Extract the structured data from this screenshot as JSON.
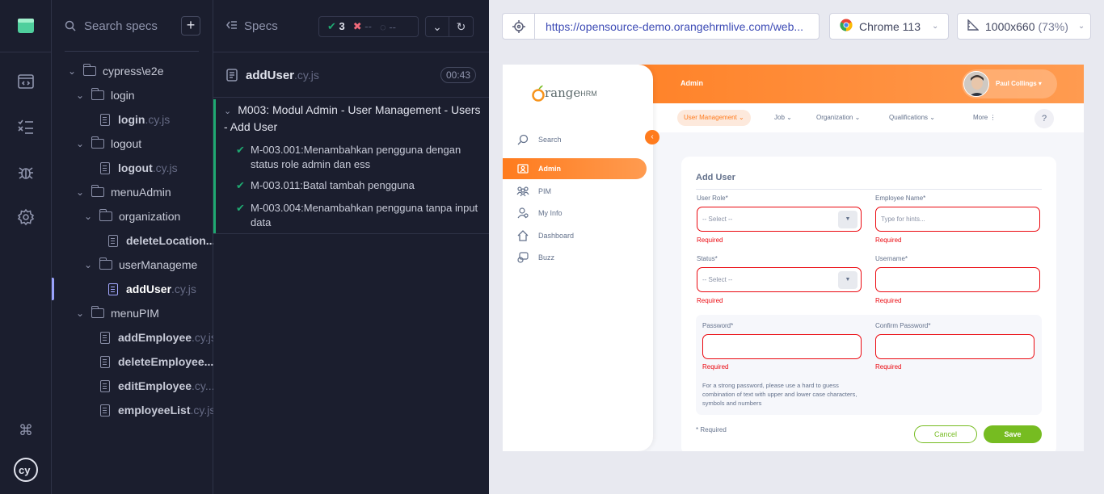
{
  "specs_panel": {
    "search_placeholder": "Search specs",
    "add_label": "+",
    "tree": {
      "root": "cypress\\e2e",
      "login_folder": "login",
      "login_file": "login",
      "logout_folder": "logout",
      "logout_file": "logout",
      "menuadmin_folder": "menuAdmin",
      "organization_folder": "organization",
      "delete_location_file": "deleteLocation...",
      "usermanagement_folder": "userManageme",
      "adduser_file": "addUser",
      "menupim_folder": "menuPIM",
      "addemployee_file": "addEmployee",
      "deleteemployee_file": "deleteEmployee...",
      "editemployee_file": "editEmployee",
      "editemployee_ext": ".cy...",
      "employeelist_file": "employeeList",
      "ext": ".cy.js"
    }
  },
  "reporter": {
    "specs_label": "Specs",
    "passed_count": "3",
    "failed_count": "--",
    "pending_count": "--",
    "spec_name": "addUser",
    "spec_ext": ".cy.js",
    "duration": "00:43",
    "suite_title": "M003: Modul Admin - User Management - Users - Add User",
    "tests": [
      "M-003.001:Menambahkan pengguna dengan status role admin dan ess",
      "M-003.011:Batal tambah pengguna",
      "M-003.004:Menambahkan pengguna tanpa input data"
    ]
  },
  "aut": {
    "url": "https://opensource-demo.orangehrmlive.com/web...",
    "browser": "Chrome 113",
    "viewport": "1000x660",
    "viewport_scale": "(73%)"
  },
  "orangehrm": {
    "logo_text_1": "range",
    "logo_text_2": "HRM",
    "topbar_title": "Admin",
    "user_name": "Paul Collings",
    "tabs": [
      "User Management",
      "Job",
      "Organization",
      "Qualifications",
      "More"
    ],
    "help": "?",
    "collapse": "‹",
    "menu": [
      "Search",
      "Admin",
      "PIM",
      "My Info",
      "Dashboard",
      "Buzz"
    ],
    "form": {
      "title": "Add User",
      "user_role_label": "User Role*",
      "user_role_value": "-- Select --",
      "employee_name_label": "Employee Name*",
      "employee_name_placeholder": "Type for hints...",
      "status_label": "Status*",
      "status_value": "-- Select --",
      "username_label": "Username*",
      "password_label": "Password*",
      "confirm_password_label": "Confirm Password*",
      "required_error": "Required",
      "password_hint": "For a strong password, please use a hard to guess combination of text with upper and lower case characters, symbols and numbers",
      "required_note": "* Required",
      "cancel": "Cancel",
      "save": "Save"
    }
  }
}
